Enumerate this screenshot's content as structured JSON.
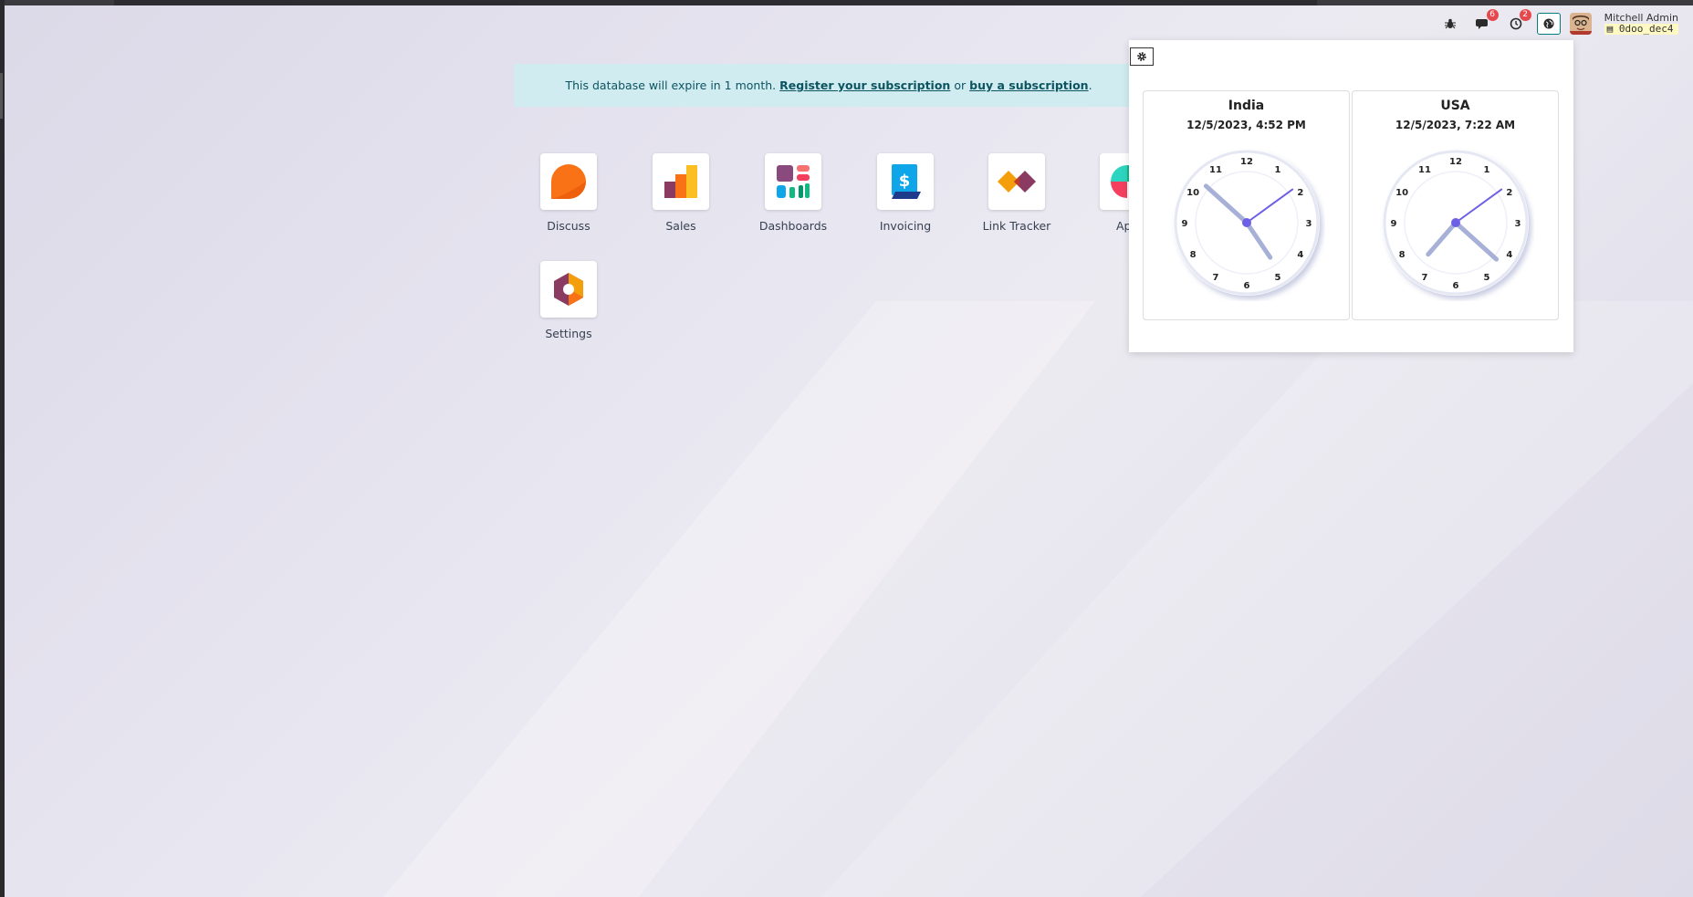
{
  "systray": {
    "debug_icon": "bug-icon",
    "messages_badge": "6",
    "activity_badge": "2",
    "world_clock_icon": "globe-icon",
    "user_name": "Mitchell Admin",
    "db_name": "0doo_dec4"
  },
  "banner": {
    "prefix": "This database will expire in 1 month.",
    "register_link": "Register your subscription",
    "or_text": "or",
    "buy_link": "buy a subscription",
    "suffix": "."
  },
  "apps": [
    {
      "label": "Discuss"
    },
    {
      "label": "Sales"
    },
    {
      "label": "Dashboards"
    },
    {
      "label": "Invoicing"
    },
    {
      "label": "Link Tracker"
    },
    {
      "label": "Ap"
    },
    {
      "label": "Settings"
    }
  ],
  "clocks": [
    {
      "name": "India",
      "datetime": "12/5/2023, 4:52 PM",
      "hour": 4,
      "minute": 52,
      "second": 9
    },
    {
      "name": "USA",
      "datetime": "12/5/2023, 7:22 AM",
      "hour": 7,
      "minute": 22,
      "second": 9
    }
  ],
  "clock_numbers": [
    "12",
    "1",
    "2",
    "3",
    "4",
    "5",
    "6",
    "7",
    "8",
    "9",
    "10",
    "11"
  ],
  "colors": {
    "accent": "#017e84",
    "banner_bg": "#d1ecf1",
    "banner_text": "#0c5460",
    "badge": "#e5484d",
    "hand_main": "#a7b0d6",
    "hand_second": "#6d5fe6"
  }
}
